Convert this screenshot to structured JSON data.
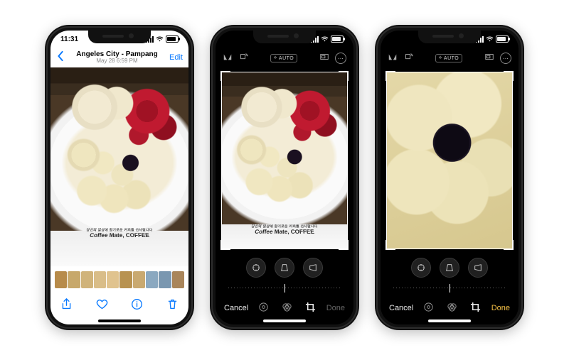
{
  "status": {
    "time": "11:31"
  },
  "viewer": {
    "back_label": "Back",
    "title": "Angeles City - Pampang",
    "subtitle": "May 28  6:59 PM",
    "edit_label": "Edit",
    "plate_text_main": "Coffee Mate, COFFEE",
    "plate_text_small": "당신의 일상에 향기로운 커피를 선사합니다",
    "toolbar": {
      "share": "Share",
      "favorite": "Favorite",
      "info": "Info",
      "trash": "Delete"
    }
  },
  "editor": {
    "auto_label": "AUTO",
    "cancel_label": "Cancel",
    "done_label": "Done",
    "crop_modes": {
      "straighten": "Straighten",
      "vertical": "Vertical",
      "horizontal": "Horizontal"
    },
    "tabs": {
      "adjust": "Adjust",
      "filters": "Filters",
      "crop": "Crop"
    }
  },
  "phone3": {
    "done_active": true
  }
}
